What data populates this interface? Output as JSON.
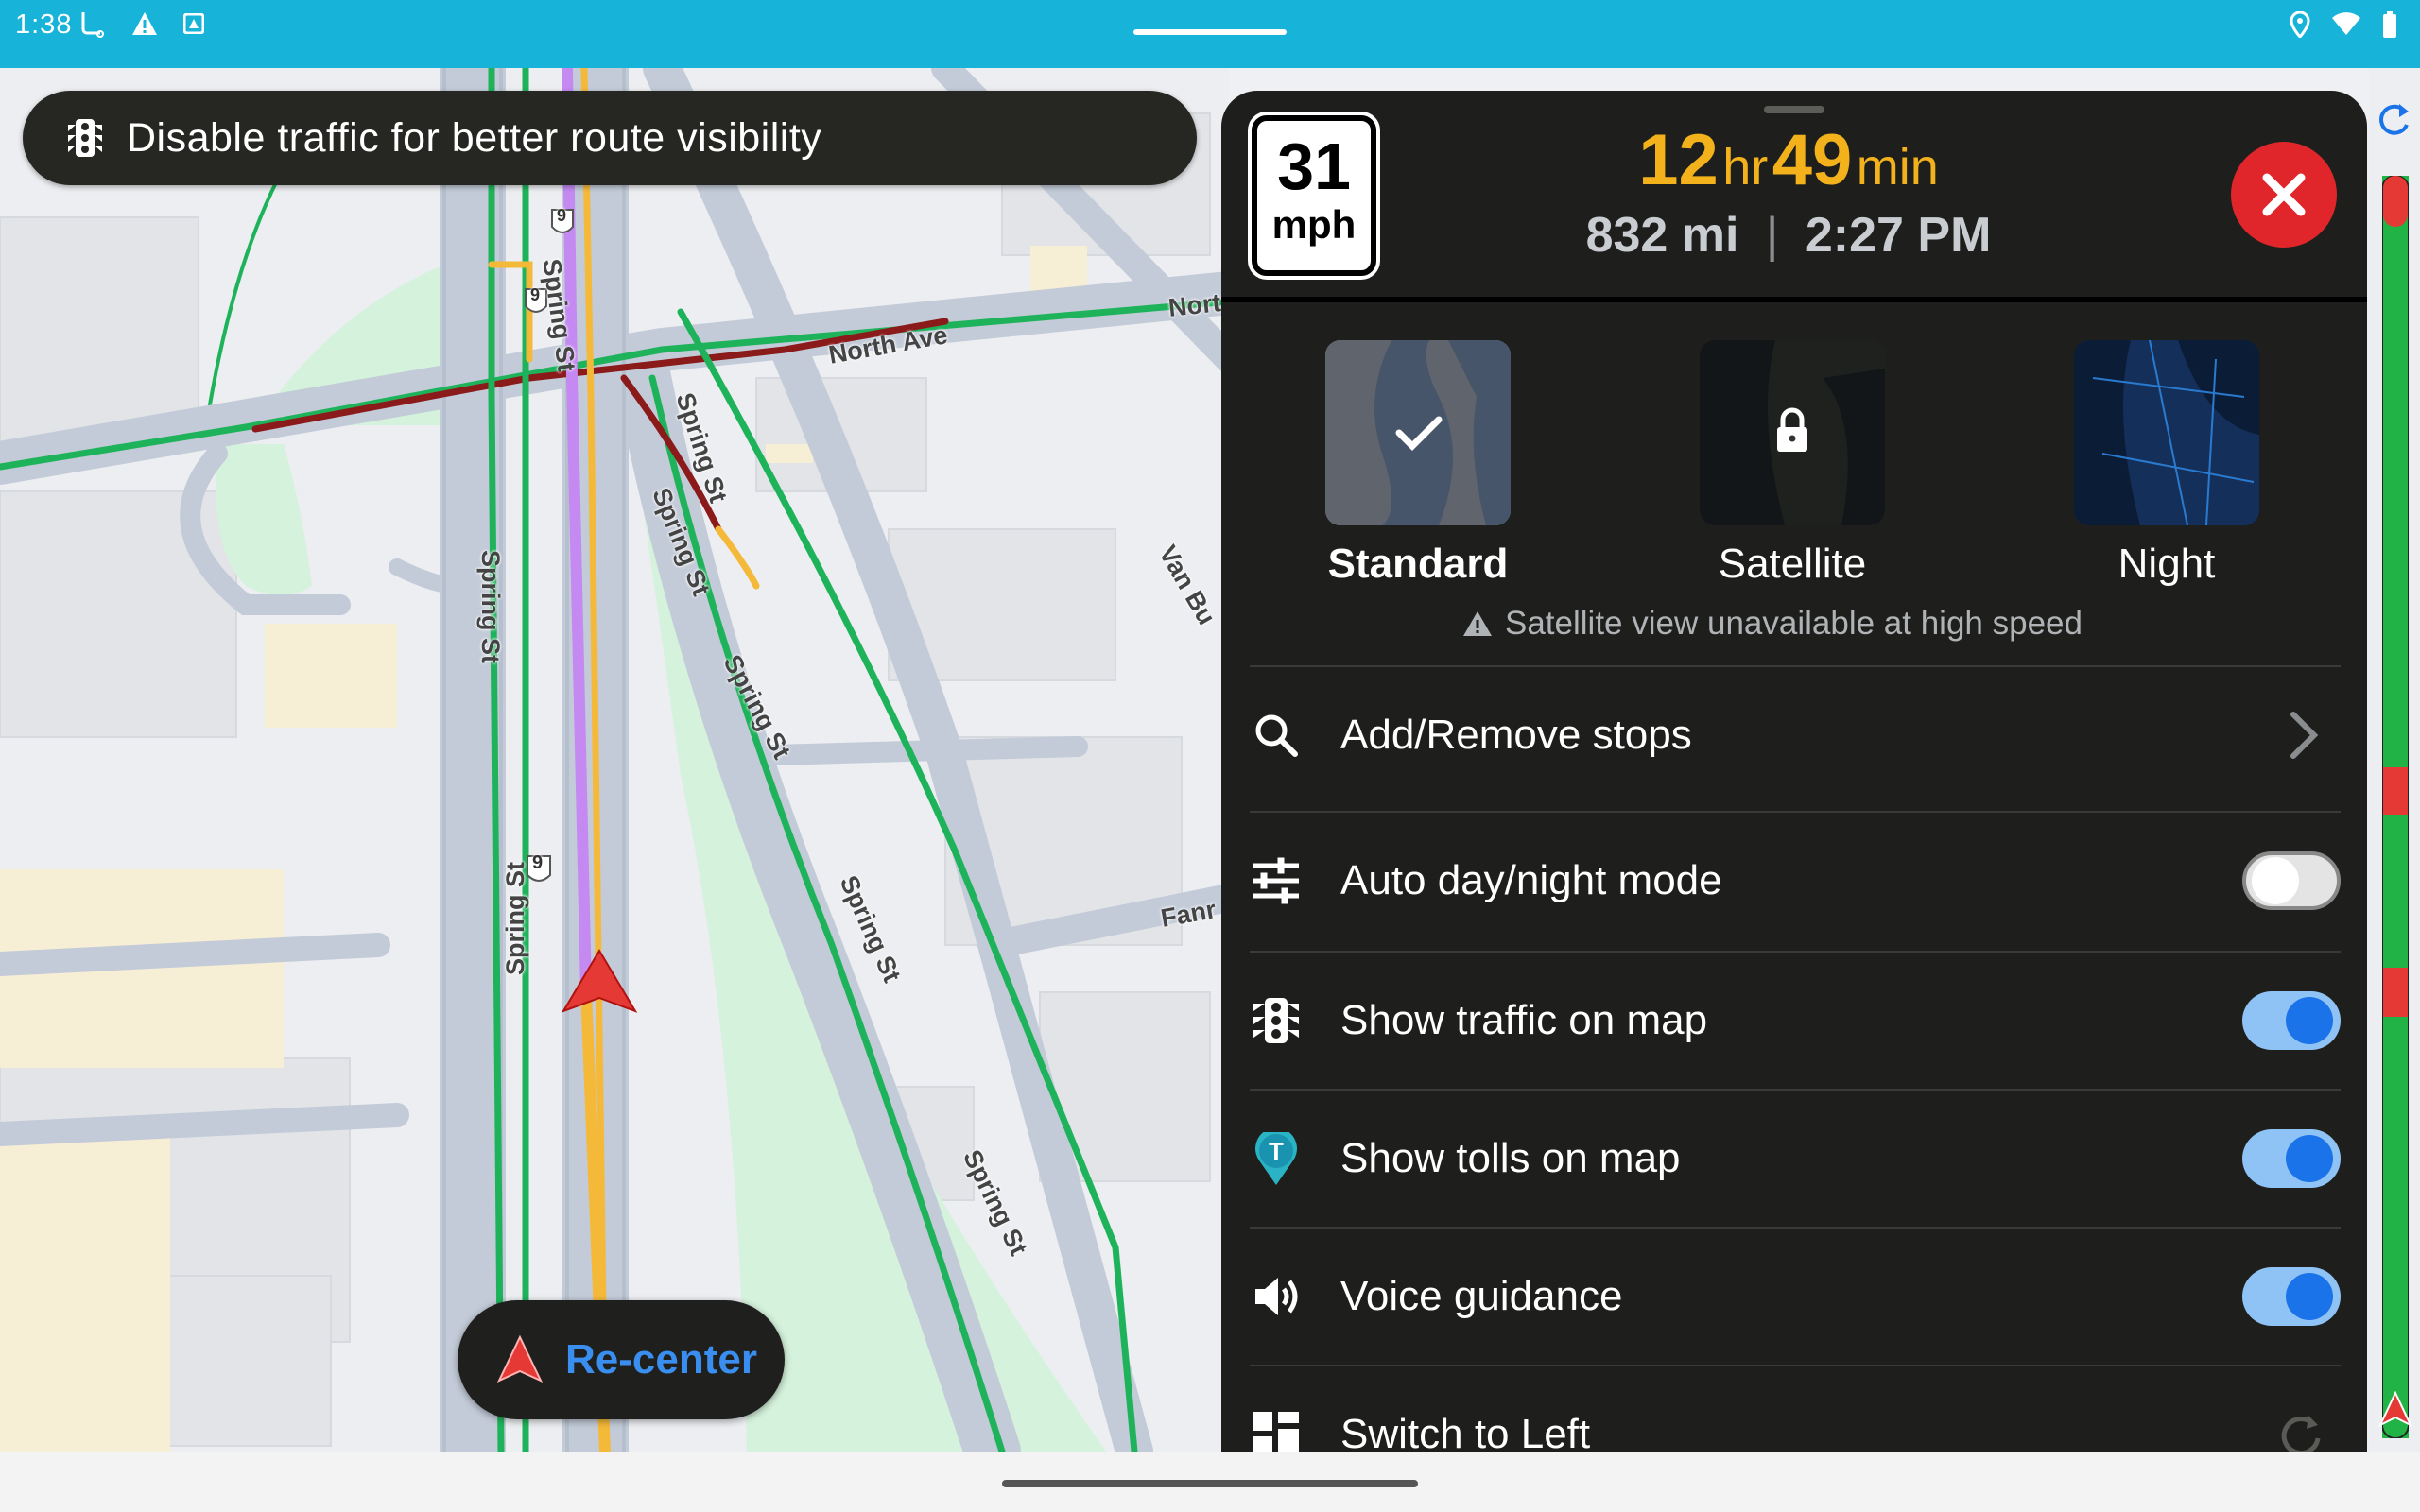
{
  "status_bar": {
    "time": "1:38",
    "left_icons": [
      "accessibility-icon",
      "warning-icon",
      "app-notification-icon"
    ],
    "right_icons": [
      "location-icon",
      "wifi-icon",
      "battery-icon"
    ]
  },
  "map": {
    "street_labels": [
      "Spring St",
      "Spring St",
      "Spring St",
      "Spring St",
      "Spring St",
      "Spring St",
      "Spring St",
      "Spring St",
      "North Ave",
      "Nort",
      "Van Bu",
      "Fanr"
    ],
    "route_shields": [
      "9",
      "9",
      "9"
    ],
    "colors": {
      "route": "#c58af2",
      "traffic_free": "#1eb35a",
      "traffic_slow": "#f5b93a",
      "traffic_heavy": "#8b1a1a"
    }
  },
  "traffic_banner": {
    "icon": "traffic-light-icon",
    "text": "Disable traffic for better route visibility"
  },
  "recenter": {
    "icon": "navigation-arrow-icon",
    "label": "Re-center"
  },
  "panel": {
    "speed_limit": {
      "value": "31",
      "unit": "mph"
    },
    "eta": {
      "hours": "12",
      "hours_unit": "hr",
      "minutes": "49",
      "minutes_unit": "min",
      "distance": "832 mi",
      "separator": "|",
      "arrival": "2:27 PM"
    },
    "close_icon": "close-icon",
    "map_styles": [
      {
        "label": "Standard",
        "selected": true,
        "badge_icon": "checkmark-icon"
      },
      {
        "label": "Satellite",
        "selected": false,
        "badge_icon": "lock-icon"
      },
      {
        "label": "Night",
        "selected": false,
        "badge_icon": ""
      }
    ],
    "warning": {
      "icon": "warning-icon",
      "text": "Satellite view unavailable at high speed"
    },
    "settings": [
      {
        "icon": "search-icon",
        "label": "Add/Remove stops",
        "control": "chevron"
      },
      {
        "icon": "tune-icon",
        "label": "Auto day/night mode",
        "control": "toggle",
        "on": false
      },
      {
        "icon": "traffic-light-icon",
        "label": "Show traffic on map",
        "control": "toggle",
        "on": true
      },
      {
        "icon": "toll-icon",
        "label": "Show tolls on map",
        "control": "toggle",
        "on": true
      },
      {
        "icon": "volume-icon",
        "label": "Voice guidance",
        "control": "toggle",
        "on": true
      },
      {
        "icon": "layout-icon",
        "label": "Switch to Left",
        "control": "rotate"
      }
    ]
  },
  "side_strip": {
    "refresh_icon": "refresh-icon",
    "progress_segments": [
      "#e53935",
      "#21b346",
      "#e53935",
      "#21b346",
      "#e53935",
      "#21b346"
    ]
  }
}
